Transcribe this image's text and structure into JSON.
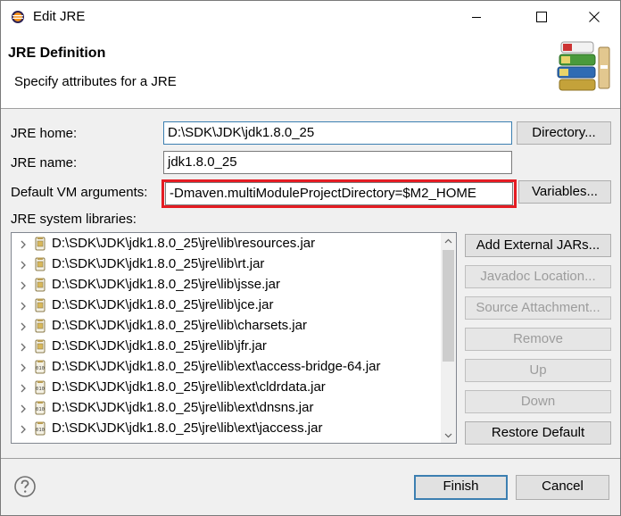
{
  "window": {
    "title": "Edit JRE",
    "minimize_icon": "minimize-icon",
    "maximize_icon": "maximize-icon",
    "close_icon": "close-icon"
  },
  "header": {
    "title": "JRE Definition",
    "description": "Specify attributes for a JRE",
    "graphic_icon": "library-books-icon"
  },
  "form": {
    "jre_home_label": "JRE home:",
    "jre_home_value": "D:\\SDK\\JDK\\jdk1.8.0_25",
    "directory_button": "Directory...",
    "jre_name_label": "JRE name:",
    "jre_name_value": "jdk1.8.0_25",
    "vm_args_label": "Default VM arguments:",
    "vm_args_value": "-Dmaven.multiModuleProjectDirectory=$M2_HOME",
    "variables_button": "Variables...",
    "libraries_label": "JRE system libraries:"
  },
  "libraries": [
    {
      "path": "D:\\SDK\\JDK\\jdk1.8.0_25\\jre\\lib\\resources.jar",
      "icon": "jar-icon"
    },
    {
      "path": "D:\\SDK\\JDK\\jdk1.8.0_25\\jre\\lib\\rt.jar",
      "icon": "jar-icon"
    },
    {
      "path": "D:\\SDK\\JDK\\jdk1.8.0_25\\jre\\lib\\jsse.jar",
      "icon": "jar-icon"
    },
    {
      "path": "D:\\SDK\\JDK\\jdk1.8.0_25\\jre\\lib\\jce.jar",
      "icon": "jar-icon"
    },
    {
      "path": "D:\\SDK\\JDK\\jdk1.8.0_25\\jre\\lib\\charsets.jar",
      "icon": "jar-icon"
    },
    {
      "path": "D:\\SDK\\JDK\\jdk1.8.0_25\\jre\\lib\\jfr.jar",
      "icon": "jar-icon"
    },
    {
      "path": "D:\\SDK\\JDK\\jdk1.8.0_25\\jre\\lib\\ext\\access-bridge-64.jar",
      "icon": "binary-jar-icon"
    },
    {
      "path": "D:\\SDK\\JDK\\jdk1.8.0_25\\jre\\lib\\ext\\cldrdata.jar",
      "icon": "binary-jar-icon"
    },
    {
      "path": "D:\\SDK\\JDK\\jdk1.8.0_25\\jre\\lib\\ext\\dnsns.jar",
      "icon": "binary-jar-icon"
    },
    {
      "path": "D:\\SDK\\JDK\\jdk1.8.0_25\\jre\\lib\\ext\\jaccess.jar",
      "icon": "binary-jar-icon"
    }
  ],
  "side_buttons": {
    "add_external": "Add External JARs...",
    "javadoc": "Javadoc Location...",
    "source": "Source Attachment...",
    "remove": "Remove",
    "up": "Up",
    "down": "Down",
    "restore": "Restore Default"
  },
  "footer": {
    "help_icon": "help-icon",
    "finish": "Finish",
    "cancel": "Cancel"
  },
  "colors": {
    "highlight_border": "#e51c23",
    "focus_border": "#3c7fb1"
  }
}
